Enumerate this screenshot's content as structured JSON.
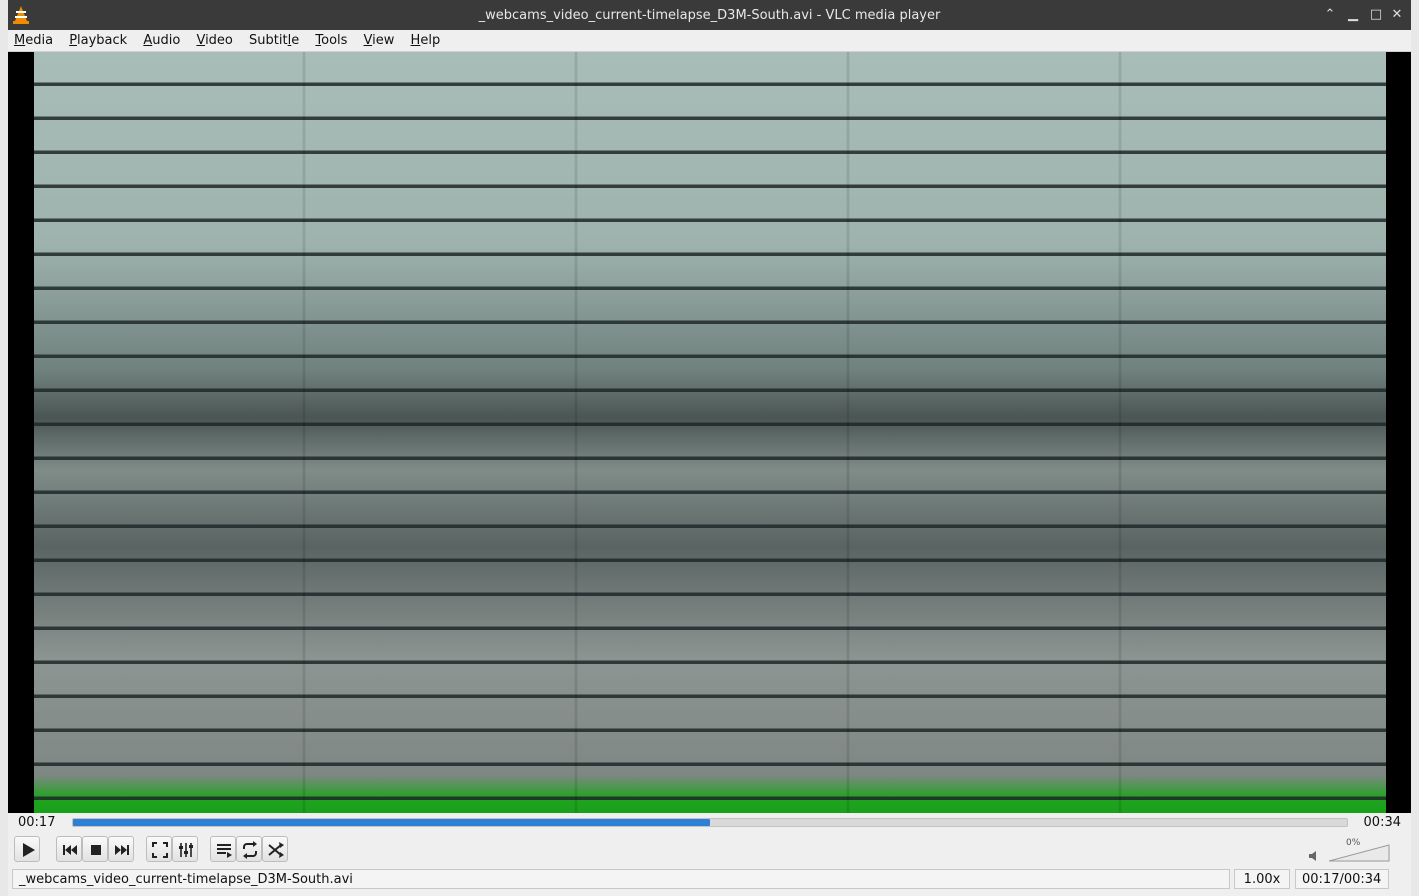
{
  "window": {
    "title": "_webcams_video_current-timelapse_D3M-South.avi - VLC media player",
    "app_icon": "vlc-cone-icon",
    "controls": {
      "minimize_icon": "▁",
      "restore_up_icon": "⌃",
      "maximize_icon": "□",
      "close_icon": "✕"
    }
  },
  "menubar": {
    "items": [
      {
        "label": "Media",
        "mnemonic": "M",
        "rest": "edia"
      },
      {
        "label": "Playback",
        "mnemonic": "P",
        "rest": "layback"
      },
      {
        "label": "Audio",
        "mnemonic": "A",
        "rest": "udio"
      },
      {
        "label": "Video",
        "mnemonic": "V",
        "rest": "ideo"
      },
      {
        "label": "Subtitle",
        "mnemonic": "S",
        "rest": "ubtit",
        "suffix_mnemonic": "l",
        "suffix_rest": "e"
      },
      {
        "label": "Tools",
        "mnemonic": "T",
        "rest": "ools"
      },
      {
        "label": "View",
        "mnemonic": "V",
        "rest": "iew"
      },
      {
        "label": "Help",
        "mnemonic": "H",
        "rest": "elp"
      }
    ]
  },
  "seek": {
    "elapsed": "00:17",
    "total": "00:34",
    "progress": 0.5
  },
  "controls": {
    "buttons": [
      "play-icon",
      "previous-icon",
      "stop-icon",
      "next-icon",
      "fullscreen-icon",
      "extended-settings-icon",
      "playlist-icon",
      "loop-icon",
      "shuffle-icon"
    ]
  },
  "volume": {
    "percent_label": "0%",
    "level": 0
  },
  "status": {
    "filename": "_webcams_video_current-timelapse_D3M-South.avi",
    "speed": "1.00x",
    "time": "00:17/00:34"
  },
  "colors": {
    "progress": "#2f7fd6",
    "titlebar": "#3a3a3a",
    "vlc_orange": "#f08a00"
  }
}
